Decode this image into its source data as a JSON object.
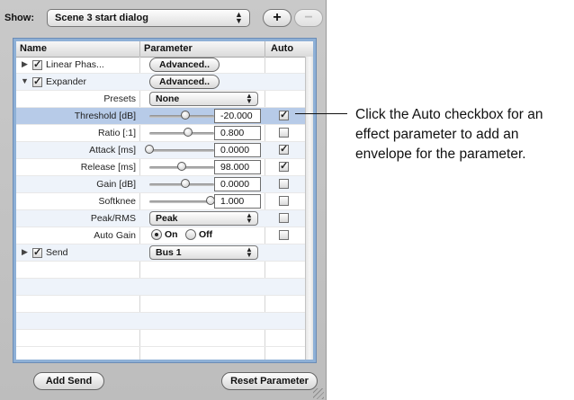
{
  "show": {
    "label": "Show:",
    "value": "Scene 3 start dialog"
  },
  "buttons": {
    "add": "+",
    "remove": "−",
    "add_send": "Add Send",
    "reset_parameter": "Reset Parameter"
  },
  "columns": {
    "name": "Name",
    "parameter": "Parameter",
    "auto": "Auto"
  },
  "rows": {
    "linear_phase": {
      "name": "Linear Phas...",
      "enabled": true,
      "button": "Advanced.."
    },
    "expander": {
      "name": "Expander",
      "enabled": true,
      "button": "Advanced.."
    },
    "presets": {
      "name": "Presets",
      "value": "None"
    },
    "threshold": {
      "name": "Threshold [dB]",
      "value": "-20.000",
      "slider_fraction": 0.55,
      "auto": true
    },
    "ratio": {
      "name": "Ratio [:1]",
      "value": "0.800",
      "slider_fraction": 0.6,
      "auto": false
    },
    "attack": {
      "name": "Attack [ms]",
      "value": "0.0000",
      "slider_fraction": 0.0,
      "auto": true
    },
    "release": {
      "name": "Release [ms]",
      "value": "98.000",
      "slider_fraction": 0.5,
      "auto": true
    },
    "gain": {
      "name": "Gain [dB]",
      "value": "0.0000",
      "slider_fraction": 0.55,
      "auto": false
    },
    "softknee": {
      "name": "Softknee",
      "value": "1.000",
      "slider_fraction": 0.95,
      "auto": false
    },
    "peak_rms": {
      "name": "Peak/RMS",
      "value": "Peak",
      "auto": false
    },
    "auto_gain": {
      "name": "Auto Gain",
      "on_label": "On",
      "off_label": "Off",
      "selected": "On",
      "auto": false
    },
    "send": {
      "name": "Send",
      "enabled": true,
      "value": "Bus 1"
    }
  },
  "callout": "Click the Auto checkbox for an effect parameter to add an envelope for the parameter.",
  "icons": {
    "collapsed": "disclosure-right-icon",
    "expanded": "disclosure-down-icon",
    "checkmark": "✓"
  }
}
